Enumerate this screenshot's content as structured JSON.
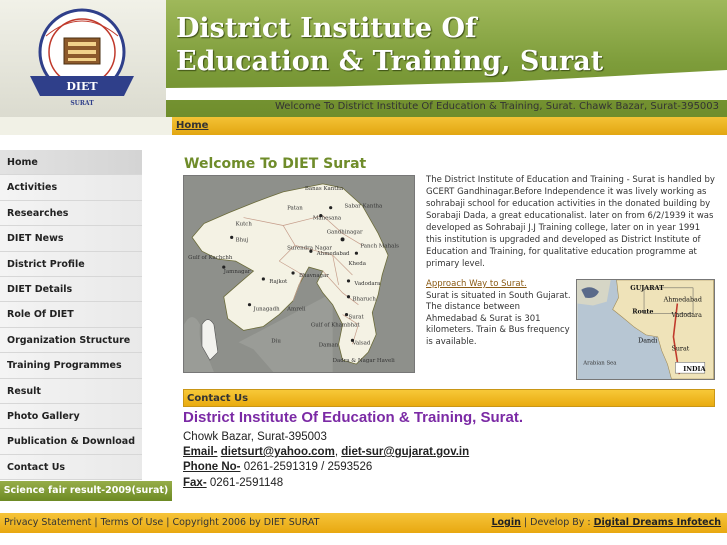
{
  "header": {
    "title_line1": "District Institute Of",
    "title_line2": "Education & Training, Surat",
    "tagline": "Welcome To District Institute Of Education & Training, Surat. Chawk Bazar, Surat-395003",
    "logo_text": "DIET",
    "logo_subtext": "SURAT"
  },
  "breadcrumb": {
    "home": "Home"
  },
  "nav": {
    "items": [
      {
        "label": "Home"
      },
      {
        "label": "Activities"
      },
      {
        "label": "Researches"
      },
      {
        "label": "DIET News"
      },
      {
        "label": "District Profile"
      },
      {
        "label": "DIET Details"
      },
      {
        "label": "Role Of DIET"
      },
      {
        "label": "Organization Structure"
      },
      {
        "label": "Training Programmes"
      },
      {
        "label": "Result"
      },
      {
        "label": "Photo Gallery"
      },
      {
        "label": "Publication & Download"
      },
      {
        "label": "Contact Us"
      }
    ],
    "science_button": "Science fair result-2009(surat)"
  },
  "main": {
    "welcome_title": "Welcome To DIET Surat",
    "intro": "The District Institute of Education and Training - Surat is handled by GCERT Gandhinagar.Before Independence it was lively working as sohrabaji school for education activities in the donated building by Sorabaji Dada, a great educationalist. later on from 6/2/1939 it was developed as Sohrabaji J.J Training college, later on in year 1991 this institution is upgraded and developed as District Institute of Education and Training, for qualitative education programme at primary level.",
    "approach_link": "Approach Way to Surat.",
    "approach_text": "Surat is situated in South Gujarat. The distance between Ahmedabad & Surat is 301 kilometers. Train & Bus frequency is available."
  },
  "gujarat_map": {
    "labels": [
      "Banas Kantha",
      "Sabar Kantha",
      "Mahesana",
      "Patan",
      "Kutch",
      "Bhuj",
      "Gandhinagar",
      "Ahmedabad",
      "Panch Mahals",
      "Kheda",
      "Surendra Nagar",
      "Gulf of Kachchh",
      "Jamnagar",
      "Rajkot",
      "Bhavnagar",
      "Junagadh",
      "Amreli",
      "Vadodara",
      "Bharuch",
      "Surat",
      "Gulf of Khambhat",
      "Valsad",
      "Diu",
      "Daman",
      "Dadra & Nagar Haveli"
    ]
  },
  "route_map": {
    "state": "GUJARAT",
    "route_label": "Route",
    "cities": [
      "Ahmedabad",
      "Vadodara",
      "Surat",
      "Dandi"
    ],
    "sea": "Arabian Sea",
    "country": "INDIA"
  },
  "contact": {
    "bar_label": "Contact Us",
    "title": "District Institute Of Education & Training, Surat.",
    "address": "Chowk Bazar, Surat-395003",
    "email_label": "Email-",
    "email1": "dietsurt@yahoo.com",
    "email_sep": ",",
    "email2": "diet-sur@gujarat.gov.in",
    "phone_label": "Phone No-",
    "phone": "0261-2591319 / 2593526",
    "fax_label": "Fax-",
    "fax": "0261-2591148"
  },
  "footer": {
    "left": "Privacy Statement | Terms Of Use | Copyright 2006 by DIET SURAT",
    "login": "Login",
    "develop_by": "| Develop By :",
    "developer": "Digital Dreams Infotech"
  },
  "colors": {
    "olive": "#7d9c3a",
    "gold": "#e9ab10",
    "purple": "#7b2aa5"
  }
}
